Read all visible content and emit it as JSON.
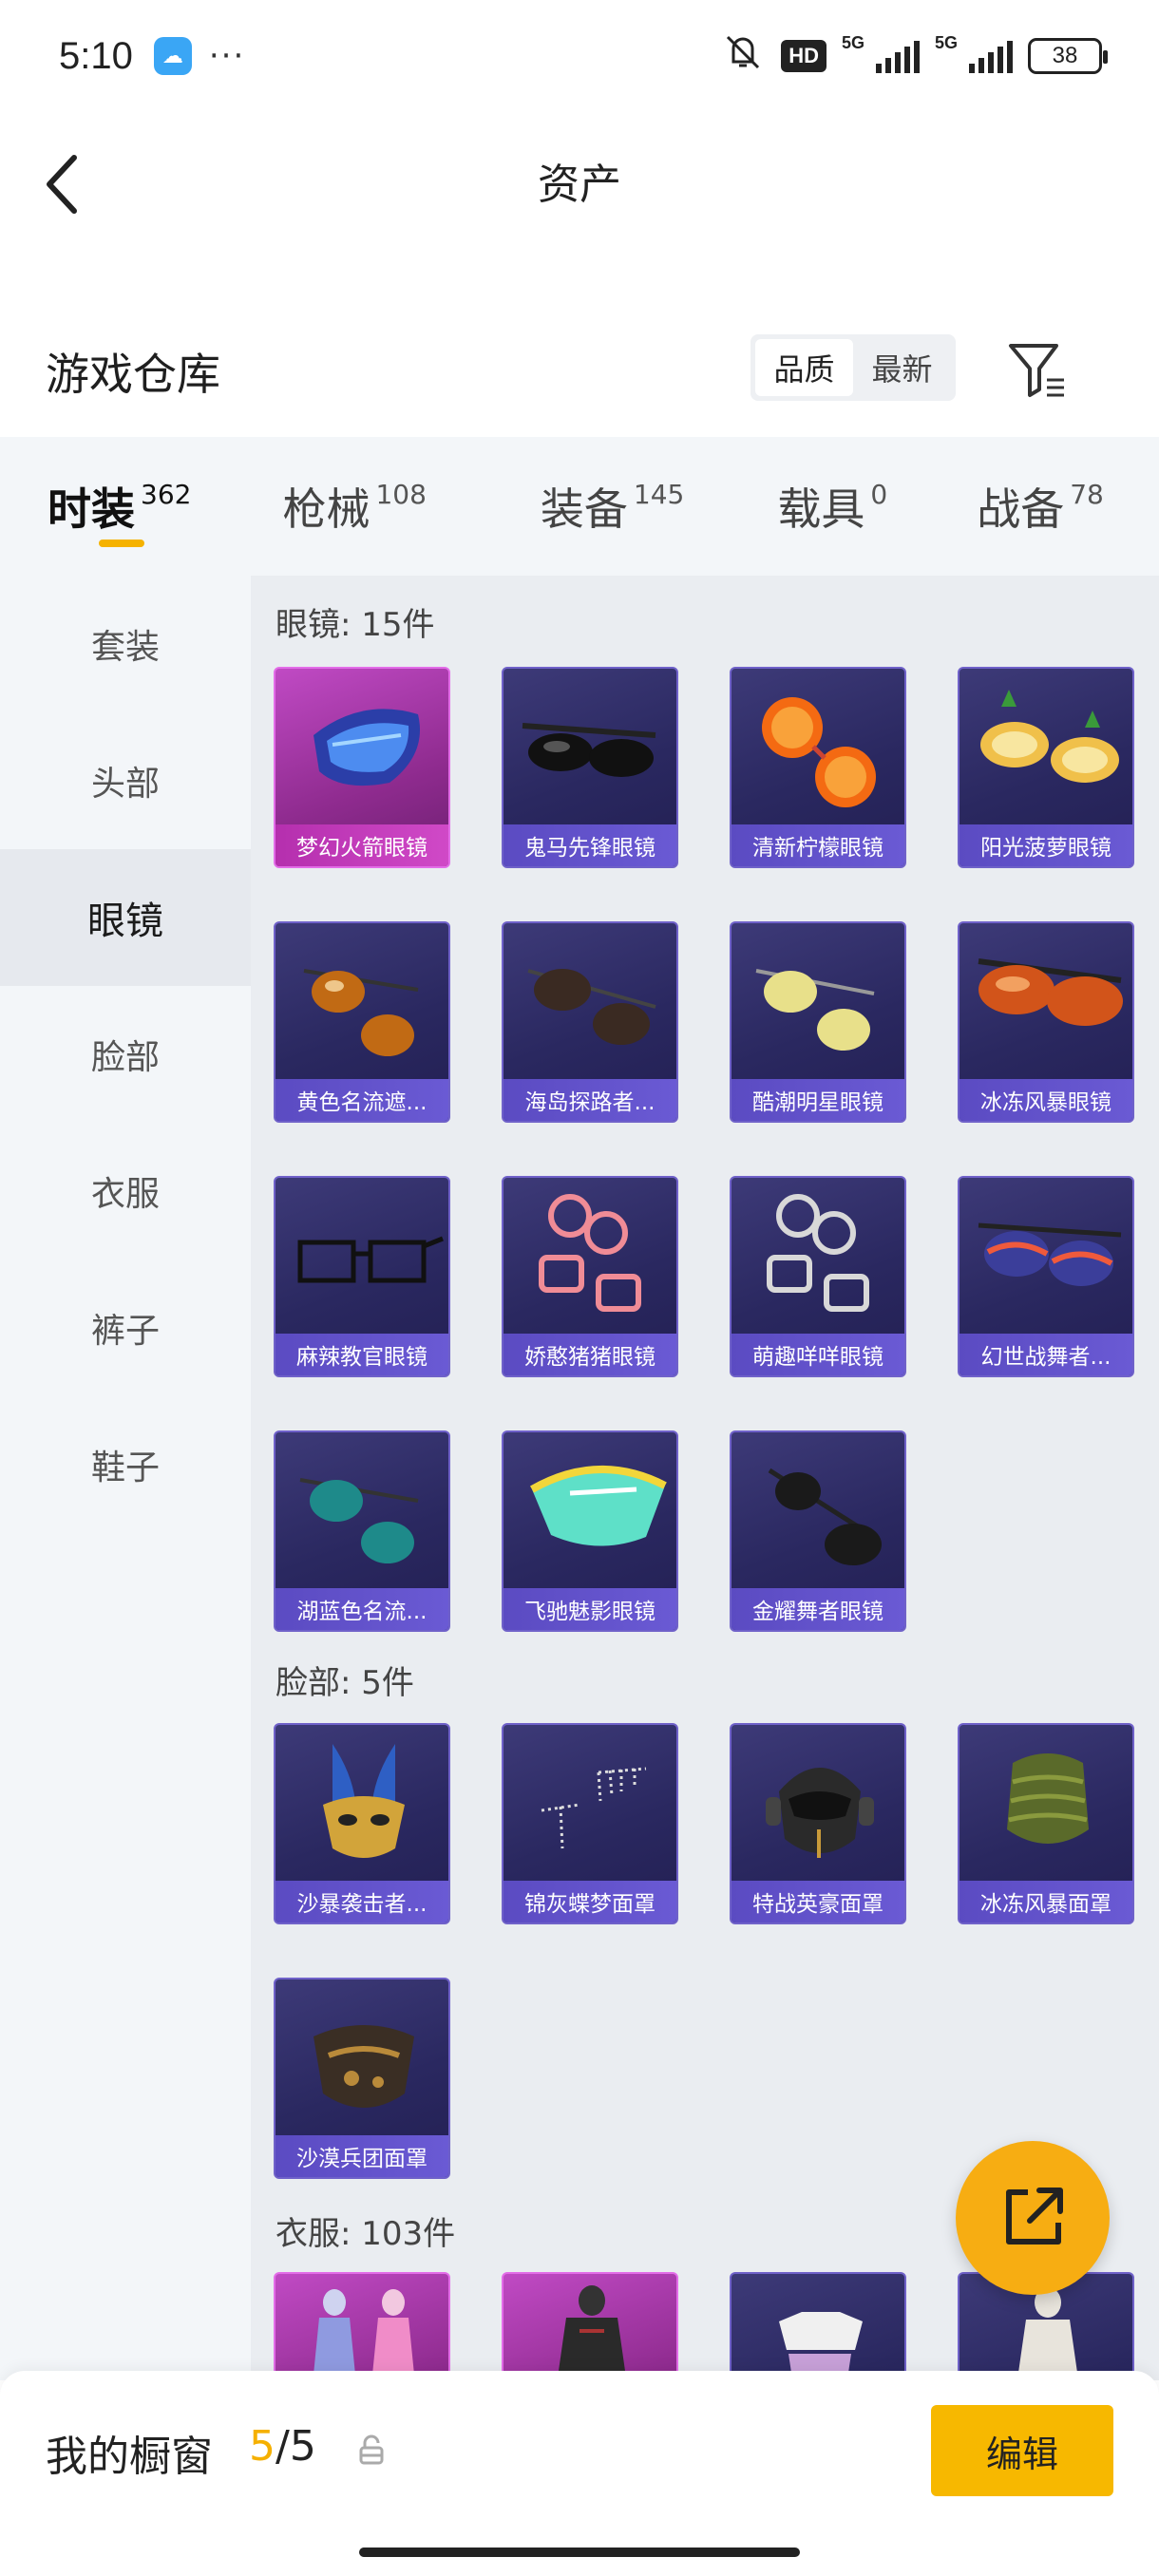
{
  "status_bar": {
    "time": "5:10",
    "battery": "38",
    "network": "5G",
    "hd_badge": "HD"
  },
  "header": {
    "title": "资产"
  },
  "section": {
    "title": "游戏仓库",
    "sort_options": [
      "品质",
      "最新"
    ],
    "sort_active": "品质"
  },
  "category_tabs": [
    {
      "label": "时装",
      "count": "362",
      "active": true
    },
    {
      "label": "枪械",
      "count": "108",
      "active": false
    },
    {
      "label": "装备",
      "count": "145",
      "active": false
    },
    {
      "label": "载具",
      "count": "0",
      "active": false
    },
    {
      "label": "战备",
      "count": "78",
      "active": false
    }
  ],
  "left_nav": [
    {
      "label": "套装",
      "active": false
    },
    {
      "label": "头部",
      "active": false
    },
    {
      "label": "眼镜",
      "active": true
    },
    {
      "label": "脸部",
      "active": false
    },
    {
      "label": "衣服",
      "active": false
    },
    {
      "label": "裤子",
      "active": false
    },
    {
      "label": "鞋子",
      "active": false
    }
  ],
  "groups": {
    "glasses": {
      "title": "眼镜: 15件",
      "items": [
        {
          "name": "梦幻火箭眼镜",
          "rarity": "legendary"
        },
        {
          "name": "鬼马先锋眼镜",
          "rarity": "epic"
        },
        {
          "name": "清新柠檬眼镜",
          "rarity": "epic"
        },
        {
          "name": "阳光菠萝眼镜",
          "rarity": "epic"
        },
        {
          "name": "黄色名流遮...",
          "rarity": "epic"
        },
        {
          "name": "海岛探路者...",
          "rarity": "epic"
        },
        {
          "name": "酷潮明星眼镜",
          "rarity": "epic"
        },
        {
          "name": "冰冻风暴眼镜",
          "rarity": "epic"
        },
        {
          "name": "麻辣教官眼镜",
          "rarity": "epic"
        },
        {
          "name": "娇憨猪猪眼镜",
          "rarity": "epic"
        },
        {
          "name": "萌趣咩咩眼镜",
          "rarity": "epic"
        },
        {
          "name": "幻世战舞者...",
          "rarity": "epic"
        },
        {
          "name": "湖蓝色名流...",
          "rarity": "epic"
        },
        {
          "name": "飞驰魅影眼镜",
          "rarity": "epic"
        },
        {
          "name": "金耀舞者眼镜",
          "rarity": "epic"
        }
      ]
    },
    "face": {
      "title": "脸部: 5件",
      "items": [
        {
          "name": "沙暴袭击者...",
          "rarity": "epic"
        },
        {
          "name": "锦灰蝶梦面罩",
          "rarity": "epic"
        },
        {
          "name": "特战英豪面罩",
          "rarity": "epic"
        },
        {
          "name": "冰冻风暴面罩",
          "rarity": "epic"
        },
        {
          "name": "沙漠兵团面罩",
          "rarity": "epic"
        }
      ]
    },
    "clothes": {
      "title": "衣服: 103件",
      "items": [
        {
          "name": "",
          "rarity": "legendary"
        },
        {
          "name": "",
          "rarity": "legendary"
        },
        {
          "name": "",
          "rarity": "epic"
        },
        {
          "name": "",
          "rarity": "epic"
        }
      ]
    }
  },
  "bottom_bar": {
    "showcase_label": "我的橱窗",
    "showcase_current": "5",
    "showcase_total": "/5",
    "edit_label": "编辑"
  },
  "colors": {
    "accent": "#f7b800",
    "tab_indicator": "#f5b200",
    "item_epic": "#2a2860",
    "item_legendary": "#b03db3",
    "name_bar_epic": "#6a5ad4",
    "name_bar_legendary": "#c43fbb"
  }
}
